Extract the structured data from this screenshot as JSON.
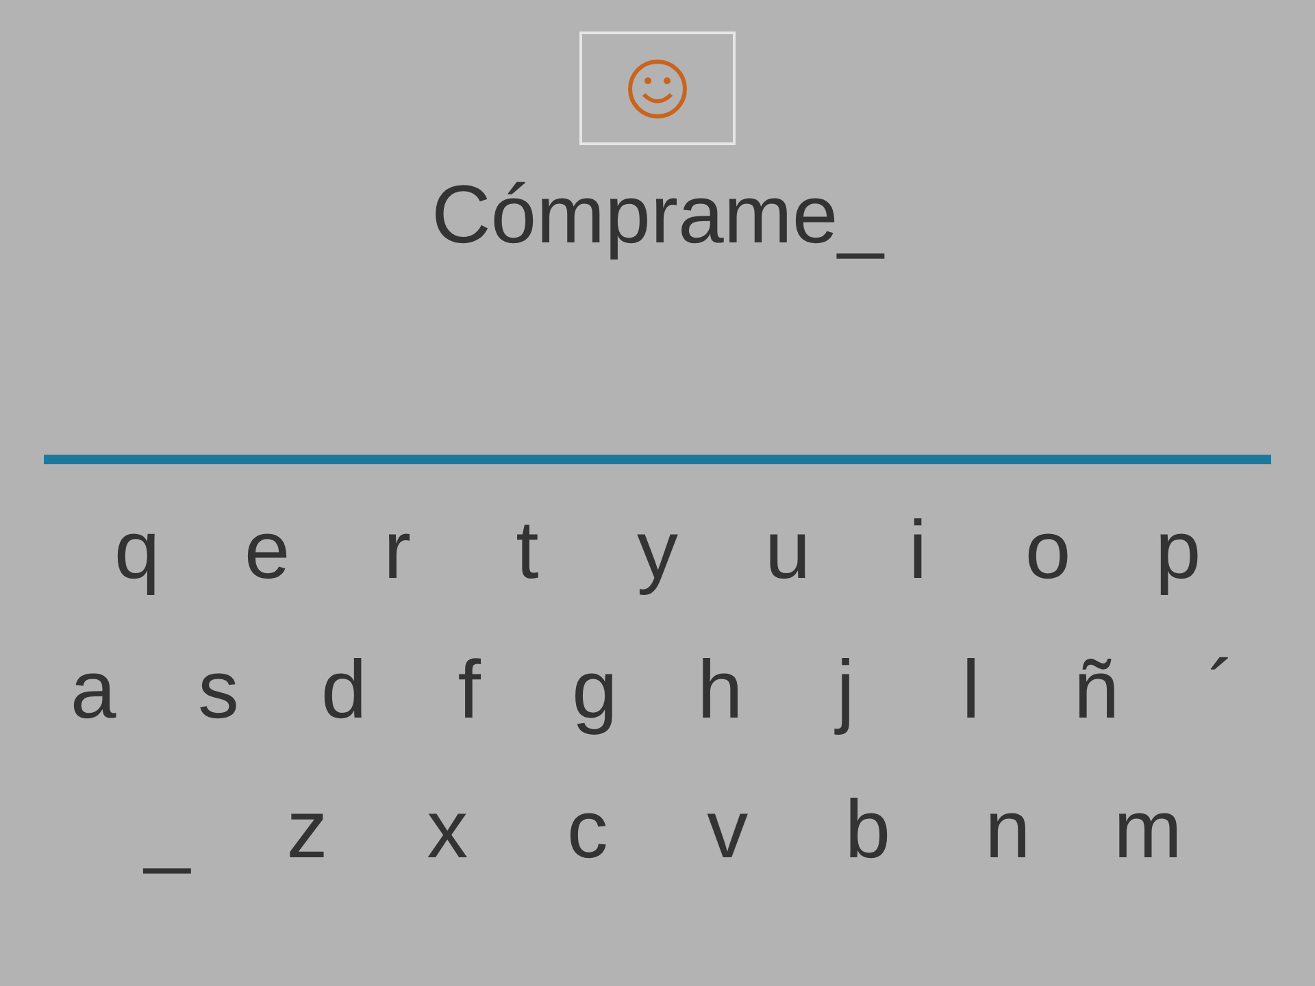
{
  "word": "Cómprame_",
  "keyboard": [
    [
      "q",
      "e",
      "r",
      "t",
      "y",
      "u",
      "i",
      "o",
      "p"
    ],
    [
      "a",
      "s",
      "d",
      "f",
      "g",
      "h",
      "j",
      "l",
      "ñ",
      "´"
    ],
    [
      "_",
      "z",
      "x",
      "c",
      "v",
      "b",
      "n",
      "m"
    ]
  ]
}
